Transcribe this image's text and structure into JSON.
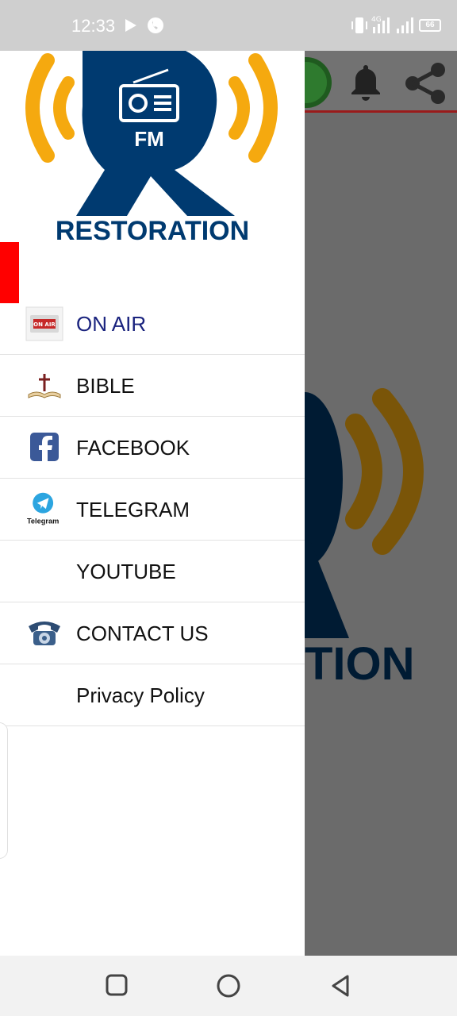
{
  "status_bar": {
    "time": "12:33",
    "battery": "66",
    "network": "4G"
  },
  "background_app": {
    "logo_text_fragment": "TION"
  },
  "drawer": {
    "logo": {
      "badge": "FM",
      "brand": "RESTORATION"
    },
    "active_color": "#ff0000",
    "items": [
      {
        "label": "ON AIR",
        "icon": "on-air-icon",
        "active": true
      },
      {
        "label": "BIBLE",
        "icon": "bible-icon",
        "active": false
      },
      {
        "label": "FACEBOOK",
        "icon": "facebook-icon",
        "active": false
      },
      {
        "label": "TELEGRAM",
        "icon": "telegram-icon",
        "icon_caption": "Telegram",
        "active": false
      },
      {
        "label": "YOUTUBE",
        "icon": "",
        "active": false
      },
      {
        "label": "CONTACT US",
        "icon": "telephone-icon",
        "active": false
      },
      {
        "label": "Privacy Policy",
        "icon": "",
        "active": false
      }
    ]
  },
  "colors": {
    "brand_blue": "#003a70",
    "brand_orange": "#f5a90f",
    "accent_red": "#ff0000"
  }
}
